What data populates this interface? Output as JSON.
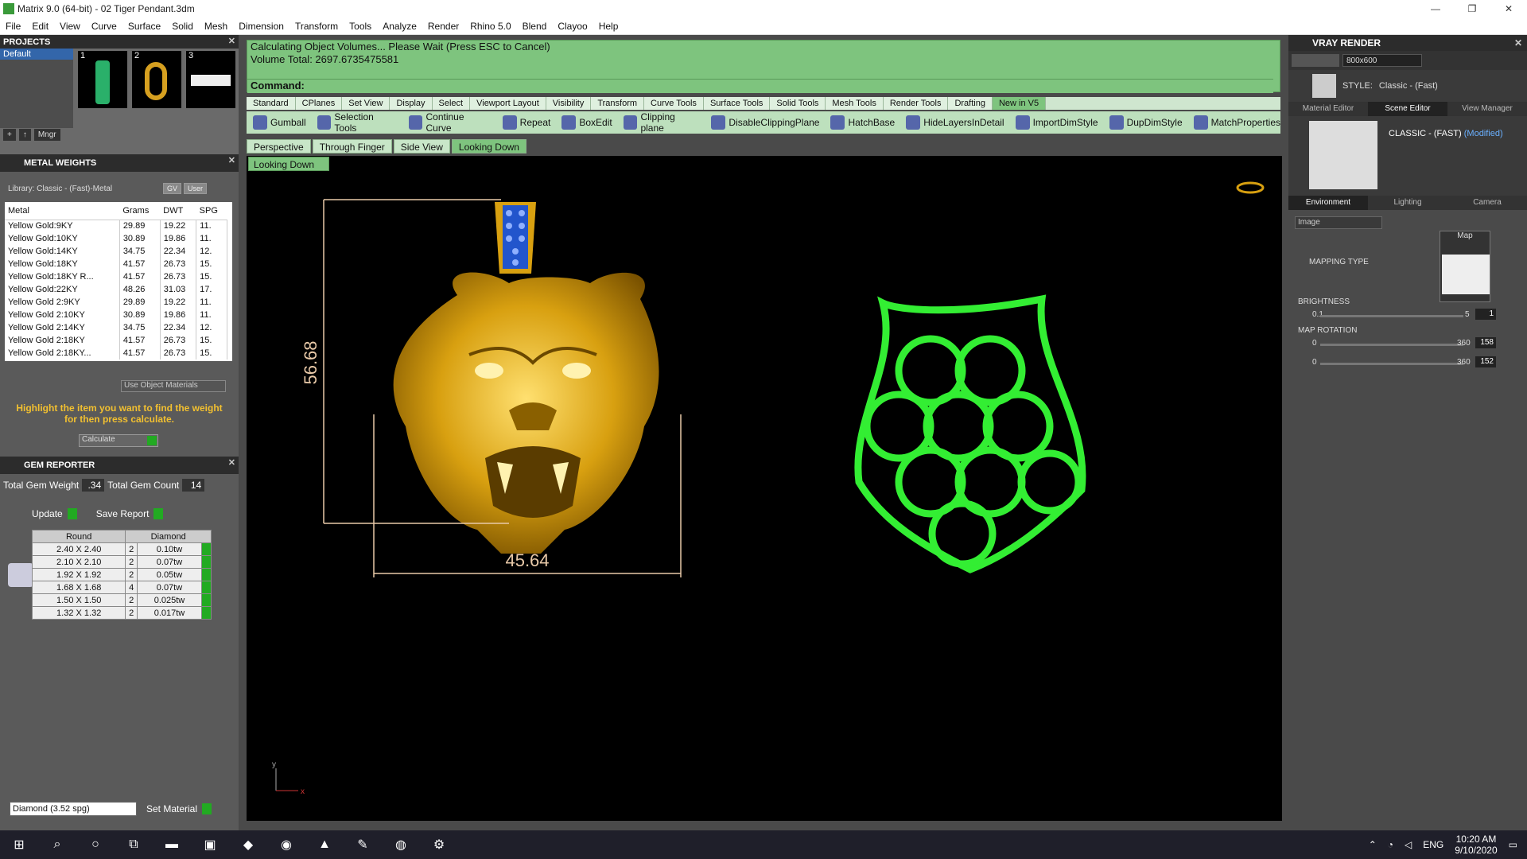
{
  "window": {
    "title": "Matrix 9.0 (64-bit) - 02 Tiger Pendant.3dm"
  },
  "menu": [
    "File",
    "Edit",
    "View",
    "Curve",
    "Surface",
    "Solid",
    "Mesh",
    "Dimension",
    "Transform",
    "Tools",
    "Analyze",
    "Render",
    "Rhino 5.0",
    "Blend",
    "Clayoo",
    "Help"
  ],
  "projects": {
    "header": "PROJECTS",
    "selected": "Default",
    "thumbs": [
      "1",
      "2",
      "3"
    ],
    "controls": [
      "+",
      "↑",
      "Mngr"
    ]
  },
  "metal_weights": {
    "header": "METAL WEIGHTS",
    "library": "Library: Classic - (Fast)-Metal",
    "lib_buttons": [
      "GV",
      "User"
    ],
    "columns": [
      "Metal",
      "Grams",
      "DWT",
      "SPG"
    ],
    "rows": [
      [
        "Yellow Gold:9KY",
        "29.89",
        "19.22",
        "11."
      ],
      [
        "Yellow Gold:10KY",
        "30.89",
        "19.86",
        "11."
      ],
      [
        "Yellow Gold:14KY",
        "34.75",
        "22.34",
        "12."
      ],
      [
        "Yellow Gold:18KY",
        "41.57",
        "26.73",
        "15."
      ],
      [
        "Yellow Gold:18KY R...",
        "41.57",
        "26.73",
        "15."
      ],
      [
        "Yellow Gold:22KY",
        "48.26",
        "31.03",
        "17."
      ],
      [
        "Yellow Gold 2:9KY",
        "29.89",
        "19.22",
        "11."
      ],
      [
        "Yellow Gold 2:10KY",
        "30.89",
        "19.86",
        "11."
      ],
      [
        "Yellow Gold 2:14KY",
        "34.75",
        "22.34",
        "12."
      ],
      [
        "Yellow Gold 2:18KY",
        "41.57",
        "26.73",
        "15."
      ],
      [
        "Yellow Gold 2:18KY...",
        "41.57",
        "26.73",
        "15."
      ]
    ],
    "use_object_materials": "Use Object Materials",
    "hint": "Highlight the item you want to find the weight for then press calculate.",
    "calculate": "Calculate"
  },
  "gem_reporter": {
    "header": "GEM REPORTER",
    "total_weight_label": "Total Gem Weight",
    "total_weight": ".34",
    "total_count_label": "Total Gem Count",
    "total_count": "14",
    "update": "Update",
    "save_report": "Save Report",
    "columns": [
      "Round",
      "Diamond"
    ],
    "rows": [
      [
        "2.40 X 2.40",
        "2",
        "0.10tw"
      ],
      [
        "2.10 X 2.10",
        "2",
        "0.07tw"
      ],
      [
        "1.92 X 1.92",
        "2",
        "0.05tw"
      ],
      [
        "1.68 X 1.68",
        "4",
        "0.07tw"
      ],
      [
        "1.50 X 1.50",
        "2",
        "0.025tw"
      ],
      [
        "1.32 X 1.32",
        "2",
        "0.017tw"
      ]
    ],
    "material": "Diamond    (3.52 spg)",
    "set_material": "Set Material"
  },
  "command": {
    "line1": "Calculating Object Volumes... Please Wait (Press ESC to Cancel)",
    "line2": "Volume Total: 2697.6735475581",
    "prompt": "Command:"
  },
  "tabs": [
    "Standard",
    "CPlanes",
    "Set View",
    "Display",
    "Select",
    "Viewport Layout",
    "Visibility",
    "Transform",
    "Curve Tools",
    "Surface Tools",
    "Solid Tools",
    "Mesh Tools",
    "Render Tools",
    "Drafting",
    "New in V5"
  ],
  "toolbar": [
    "Gumball",
    "Selection Tools",
    "Continue Curve",
    "Repeat",
    "BoxEdit",
    "Clipping plane",
    "DisableClippingPlane",
    "HatchBase",
    "HideLayersInDetail",
    "ImportDimStyle",
    "DupDimStyle",
    "MatchProperties"
  ],
  "viewport_tabs": [
    "Perspective",
    "Through Finger",
    "Side View",
    "Looking Down"
  ],
  "viewport_name": "Looking Down",
  "dimensions": {
    "height": "56.68",
    "width": "45.64"
  },
  "axis": {
    "y": "y",
    "x": "x"
  },
  "vray": {
    "header": "VRAY RENDER",
    "resolution": "800x600",
    "style_label": "STYLE:",
    "style": "Classic - (Fast)",
    "tabs": [
      "Material Editor",
      "Scene Editor",
      "View Manager"
    ],
    "scene_name": "CLASSIC - (FAST)",
    "scene_modified": "(Modified)",
    "env_tabs": [
      "Environment",
      "Lighting",
      "Camera"
    ],
    "env_type": "Image",
    "mapping_type": "MAPPING TYPE",
    "map_label": "Map",
    "brightness_label": "BRIGHTNESS",
    "brightness_min": "0.1",
    "brightness_max": "5",
    "brightness_value": "1",
    "rotation_label": "MAP ROTATION",
    "rot_min": "0",
    "rot_max": "360",
    "rot1_value": "158",
    "rot2_value": "152"
  },
  "taskbar": {
    "lang": "ENG",
    "time": "10:20 AM",
    "date": "9/10/2020"
  }
}
